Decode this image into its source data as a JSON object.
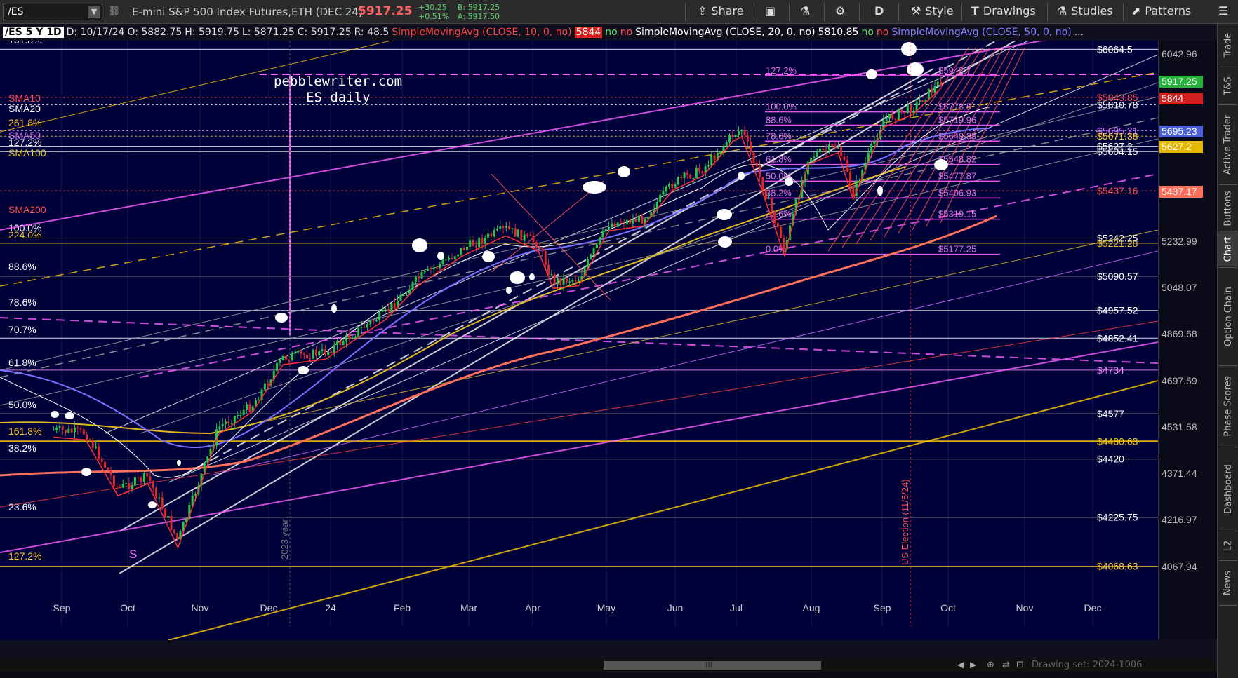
{
  "toolbar": {
    "symbol": "/ES",
    "description": "E-mini S&P 500 Index Futures,ETH (DEC 24)",
    "last_price": "5917.25",
    "change_abs": "+30.25",
    "change_pct": "+0.51%",
    "bid": "B: 5917.25",
    "ask": "A: 5917.50",
    "share_label": "Share",
    "aggregation": "D",
    "style_label": "Style",
    "drawings_label": "Drawings",
    "studies_label": "Studies",
    "patterns_label": "Patterns"
  },
  "legend": {
    "title": "/ES 5 Y 1D",
    "date": "D: 10/17/24",
    "open": "O: 5882.75",
    "high": "H: 5919.75",
    "low": "L: 5871.25",
    "close": "C: 5917.25",
    "range": "R: 48.5",
    "sma10_name": "SimpleMovingAvg (CLOSE, 10, 0, no)",
    "sma10_value": "5844",
    "sma20_name": "SimpleMovingAvg (CLOSE, 20, 0, no)",
    "sma20_value": "5810.85",
    "sma50_name": "SimpleMovingAvg (CLOSE, 50, 0, no)",
    "flag_no": "no",
    "ellipsis": "..."
  },
  "chart_data": {
    "type": "candlestick",
    "watermark_line1": "pebblewriter.com",
    "watermark_line2": "ES daily",
    "x_tick_labels": [
      "Sep",
      "Oct",
      "Nov",
      "Dec",
      "24",
      "Feb",
      "Mar",
      "Apr",
      "May",
      "Jun",
      "Jul",
      "Aug",
      "Sep",
      "Oct",
      "Nov",
      "Dec"
    ],
    "y_axis_ticks": [
      "6042.96",
      "5232.99",
      "5048.07",
      "4869.68",
      "4697.59",
      "4531.58",
      "4371.44",
      "4216.97",
      "4067.94"
    ],
    "y_range": [
      4050,
      6100
    ],
    "close_path": [
      [
        "2023-08-30",
        4520
      ],
      [
        "2023-09-14",
        4510
      ],
      [
        "2023-09-29",
        4320
      ],
      [
        "2023-10-13",
        4360
      ],
      [
        "2023-10-27",
        4150
      ],
      [
        "2023-11-15",
        4530
      ],
      [
        "2023-12-01",
        4610
      ],
      [
        "2023-12-15",
        4780
      ],
      [
        "2024-01-04",
        4800
      ],
      [
        "2024-01-19",
        4880
      ],
      [
        "2024-02-01",
        4950
      ],
      [
        "2024-02-16",
        5080
      ],
      [
        "2024-03-08",
        5200
      ],
      [
        "2024-03-28",
        5280
      ],
      [
        "2024-04-12",
        5220
      ],
      [
        "2024-04-19",
        5070
      ],
      [
        "2024-05-01",
        5080
      ],
      [
        "2024-05-15",
        5300
      ],
      [
        "2024-05-31",
        5320
      ],
      [
        "2024-06-14",
        5470
      ],
      [
        "2024-06-28",
        5530
      ],
      [
        "2024-07-12",
        5680
      ],
      [
        "2024-07-16",
        5700
      ],
      [
        "2024-07-25",
        5480
      ],
      [
        "2024-08-05",
        5200
      ],
      [
        "2024-08-16",
        5580
      ],
      [
        "2024-08-30",
        5630
      ],
      [
        "2024-09-06",
        5430
      ],
      [
        "2024-09-20",
        5740
      ],
      [
        "2024-10-04",
        5800
      ],
      [
        "2024-10-17",
        5917.25
      ]
    ],
    "sma_labels": [
      {
        "text": "SMA10",
        "color": "#ff5050"
      },
      {
        "text": "SMA20",
        "color": "#ffffff"
      },
      {
        "text": "SMA50",
        "color": "#d070ff"
      },
      {
        "text": "SMA100",
        "color": "#e0d030"
      },
      {
        "text": "SMA200",
        "color": "#ff5050"
      }
    ],
    "left_fib_labels": [
      "161.8%",
      "261.8%",
      "127.2%",
      "100.0%",
      "224.0%",
      "88.6%",
      "78.6%",
      "70.7%",
      "61.8%",
      "50.0%",
      "161.8%",
      "38.2%",
      "23.6%",
      "127.2%"
    ],
    "inner_fib_labels": [
      "127.2%",
      "100.0%",
      "88.6%",
      "78.6%",
      "61.8%",
      "50.0%",
      "38.2%",
      "23.6%",
      "0.0%"
    ],
    "inner_fib_prices": [
      "$5942.7",
      "$5778.5",
      "$5719.96",
      "$5649.83",
      "$5548.82",
      "$5477.87",
      "$5406.93",
      "$5319.15",
      "$5177.25"
    ],
    "right_level_labels": [
      "$6064.5",
      "$5843.85",
      "$5810.78",
      "$5695.21",
      "$5671.38",
      "$5627.2",
      "$5604.15",
      "$5437.16",
      "$5242.25",
      "$5221.28",
      "$5090.57",
      "$4957.52",
      "$4852.41",
      "$4734",
      "$4577",
      "$4480.63",
      "$4420",
      "$4225.75",
      "$4068.63"
    ],
    "price_axis_badges": [
      {
        "text": "5917.25",
        "color": "#26b33a"
      },
      {
        "text": "5844",
        "color": "#d21f1f"
      },
      {
        "text": "5695.23",
        "color": "#4b5fd6"
      },
      {
        "text": "5627.2",
        "color": "#e6b800"
      },
      {
        "text": "5437.17",
        "color": "#ff6f5a"
      }
    ],
    "annotation_year": "2023 year",
    "annotation_election": "US Election (11/5/24)",
    "annotation_s": "S"
  },
  "right_tabs": [
    "Trade",
    "T&S",
    "Active Trader",
    "Buttons",
    "Chart",
    "Option Chain",
    "Phase Scores",
    "Dashboard",
    "L2",
    "News"
  ],
  "scrollbar": {
    "drawing_set": "Drawing set: 2024-1006"
  }
}
